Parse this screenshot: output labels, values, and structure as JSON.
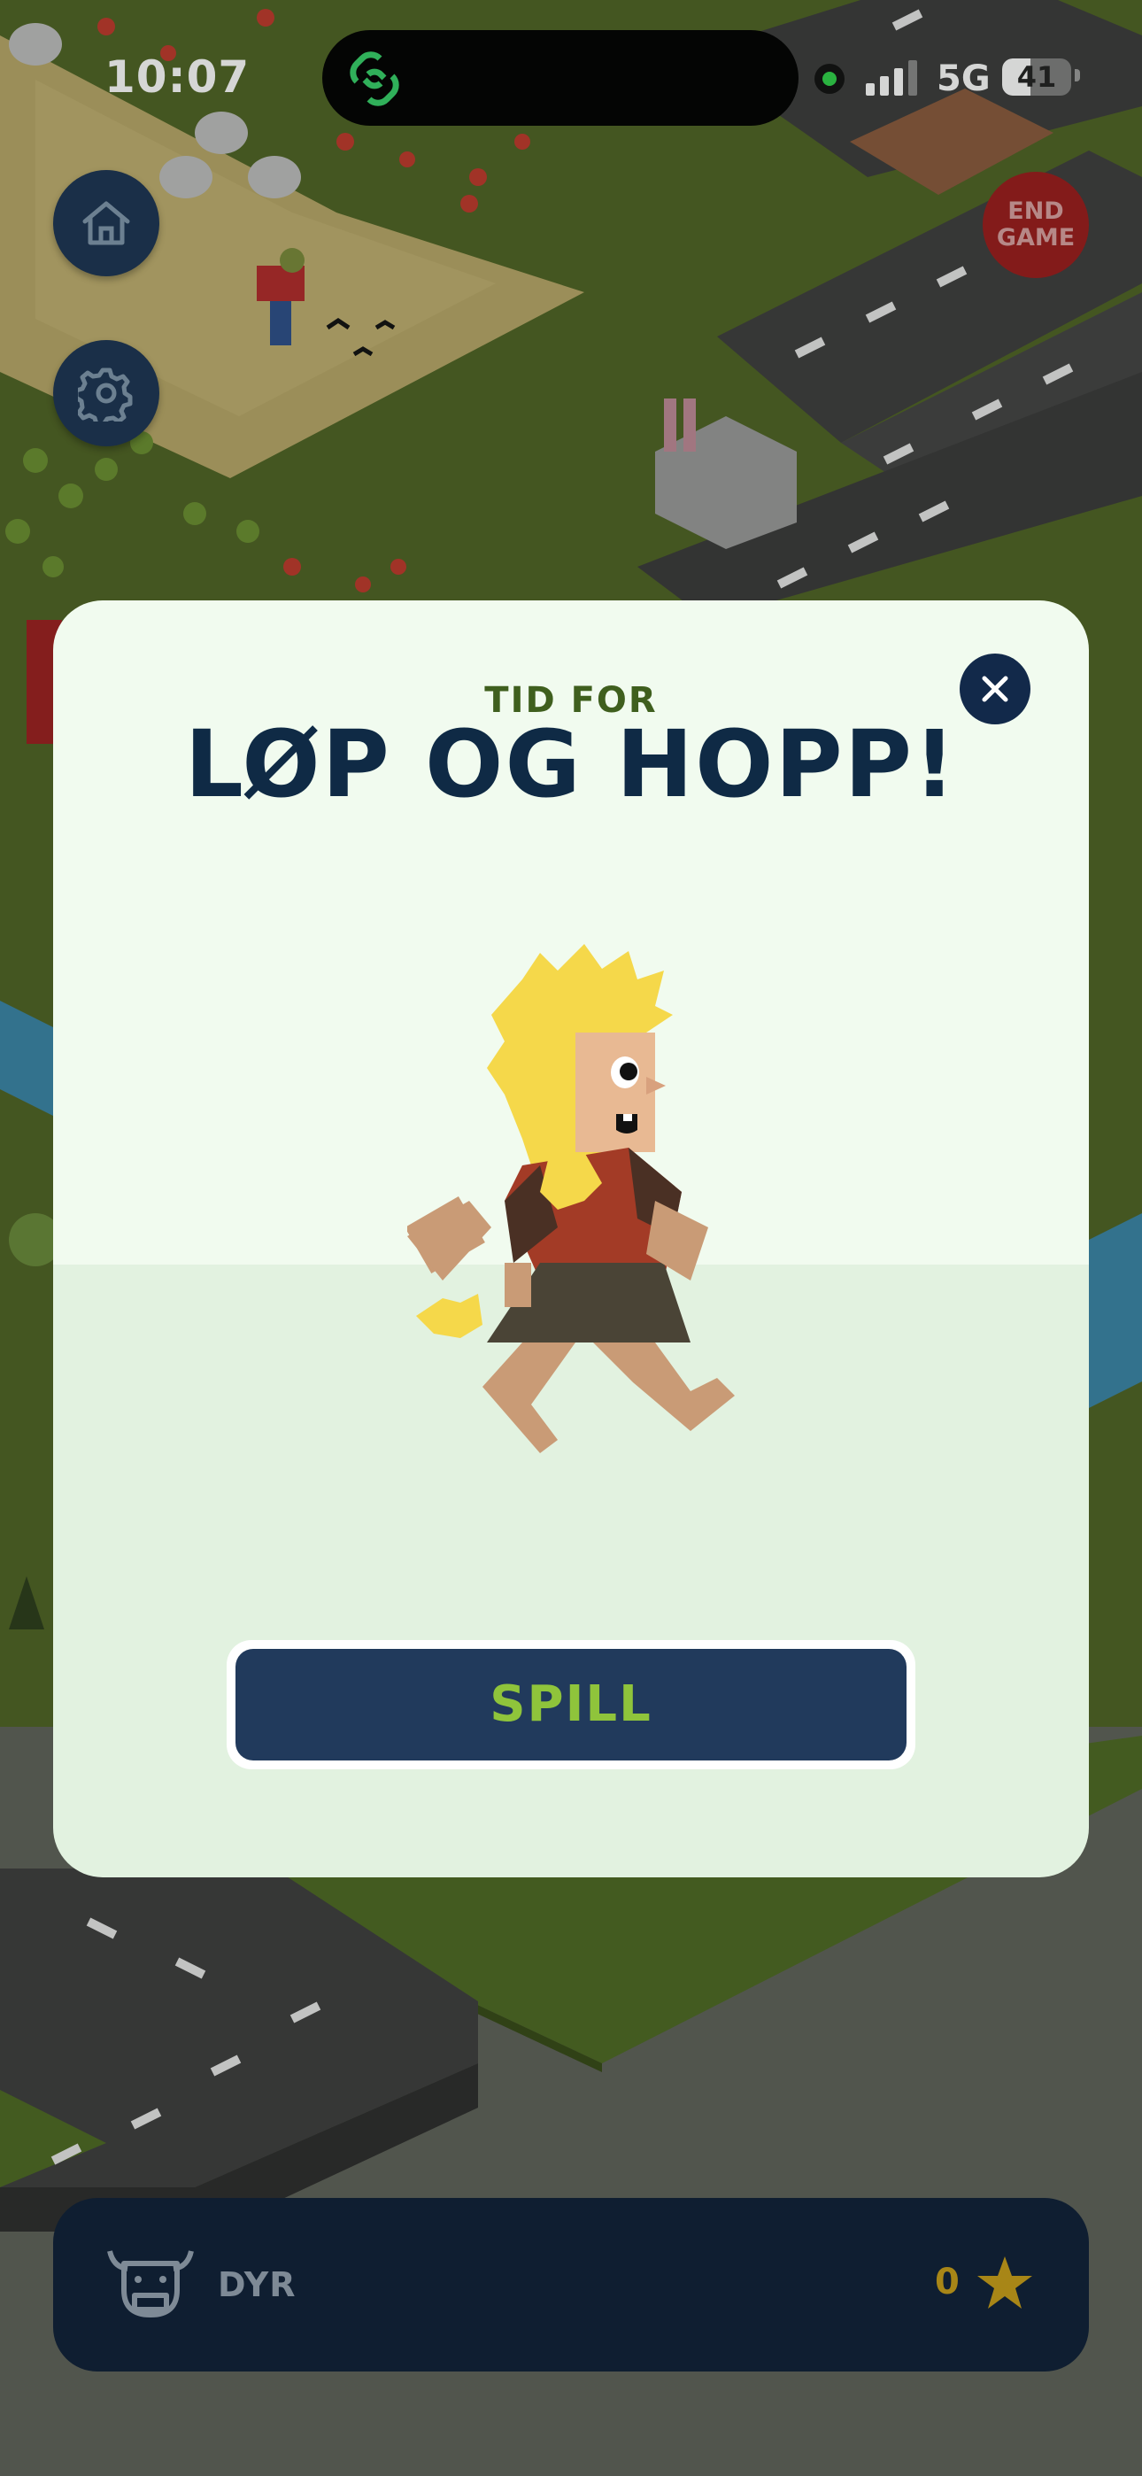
{
  "status_bar": {
    "time": "10:07",
    "network": "5G",
    "battery": "41",
    "battery_level": 0.41
  },
  "top_controls": {
    "home_icon": "home-icon",
    "settings_icon": "gear-icon",
    "end_game_label": "END GAME"
  },
  "modal": {
    "subtitle": "TID FOR",
    "title": "LØP OG HOPP!",
    "close_icon": "close-icon",
    "play_label": "SPILL"
  },
  "bottom_bar": {
    "label": "DYR",
    "icon": "cow-icon",
    "stars": "0",
    "star_icon": "star-icon"
  },
  "colors": {
    "modal_bg": "#f1fbef",
    "title": "#0f2a45",
    "play_button": "#213a5c",
    "play_text": "#8fc43b",
    "end_game": "#9c1c1c"
  }
}
